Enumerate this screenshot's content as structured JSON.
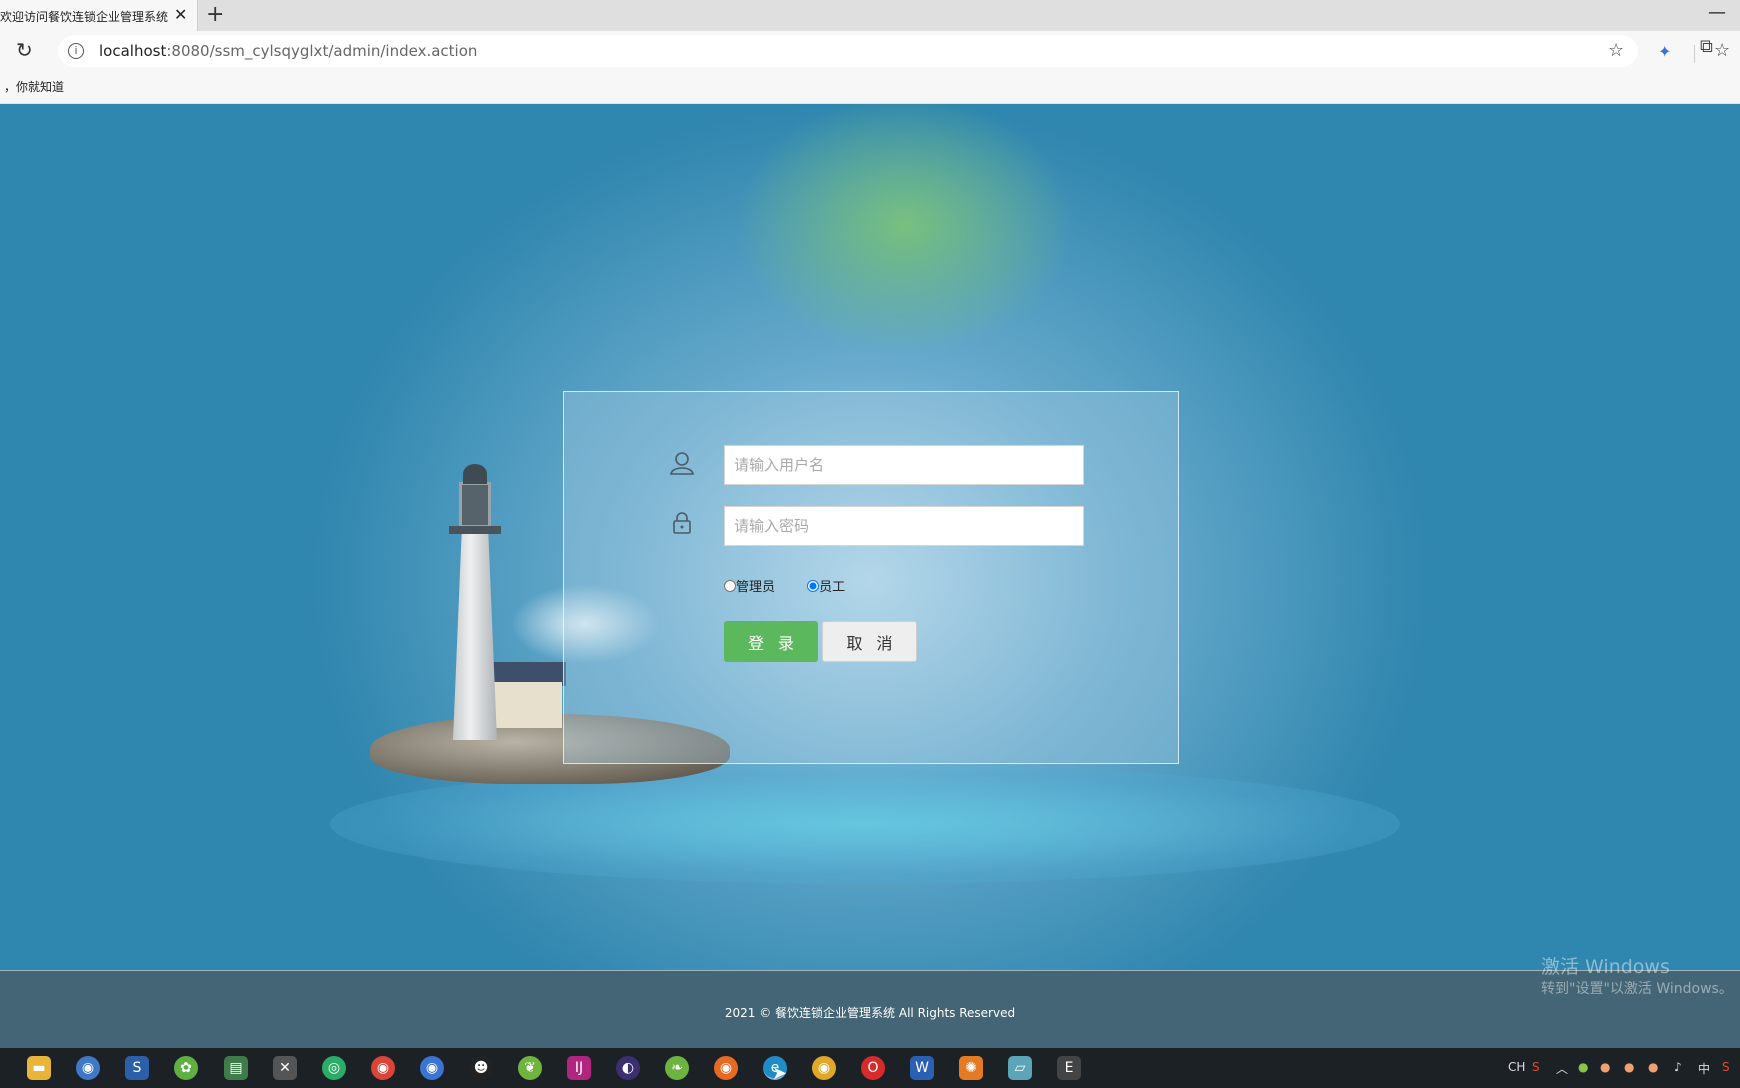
{
  "browser": {
    "tab_title": "欢迎访问餐饮连锁企业管理系统",
    "tab_close": "✕",
    "new_tab": "+",
    "minimize": "—",
    "url_host": "localhost",
    "url_path": ":8080/ssm_cylsqyglxt/admin/index.action",
    "bookmark": "，你就知道"
  },
  "login": {
    "username_placeholder": "请输入用户名",
    "password_placeholder": "请输入密码",
    "role_options": [
      "管理员",
      "员工"
    ],
    "selected_role": "员工",
    "login_button": "登录",
    "cancel_button": "取消"
  },
  "footer": {
    "text": "2021 © 餐饮连锁企业管理系统 All Rights Reserved"
  },
  "watermark": {
    "line1": "激活 Windows",
    "line2": "转到\"设置\"以激活 Windows。"
  },
  "taskbar": {
    "tray_lang": "CH",
    "tray_ime": "中",
    "icons": [
      "file-explorer-icon",
      "browser-globe-icon",
      "app-s-icon",
      "app-green-icon",
      "app-book-icon",
      "app-tools-icon",
      "wechat-icon",
      "chrome-icon",
      "chromium-icon",
      "qq-icon",
      "app-leaf-icon",
      "intellij-icon",
      "eclipse-icon",
      "spring-icon",
      "firefox-icon",
      "edge-icon",
      "app-chrome2-icon",
      "opera-icon",
      "word-icon",
      "app-gear-icon",
      "app-notes-icon",
      "app-editor-icon"
    ]
  },
  "colors": {
    "login_green": "#5cb85c",
    "footer_bg": "#446575",
    "page_blue": "#2f86ae"
  }
}
